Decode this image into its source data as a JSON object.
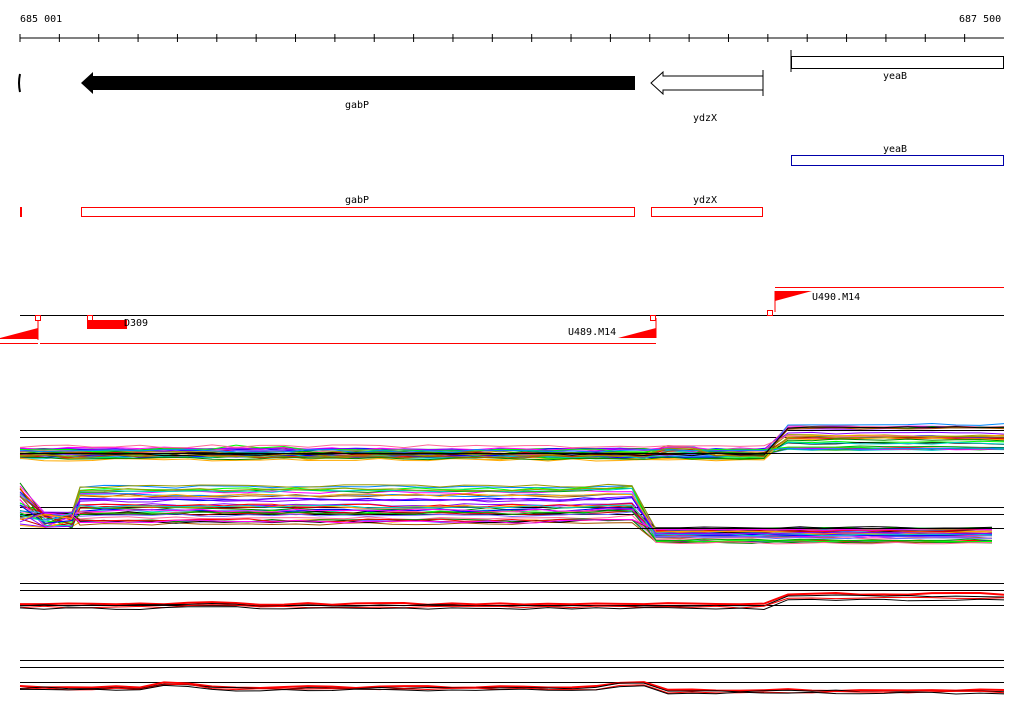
{
  "ruler": {
    "start_label": "685 001",
    "end_label": "687 500"
  },
  "genes": {
    "gabP_label": "gabP",
    "ydzX_label": "ydzX",
    "yeaB_label": "yeaB",
    "yeaB2_label": "yeaB",
    "gabP2_label": "gabP",
    "ydzX2_label": "ydzX"
  },
  "transcripts": {
    "u490_label": "U490.M14",
    "u489_label": "U489.M14",
    "d309_label": "D309"
  },
  "colors": {
    "gene_fill": "#000000",
    "feature_red": "#ff0000",
    "feature_blue": "#0000aa",
    "track_line": "#000000"
  },
  "tracks": [
    {
      "name": "expression-track-1",
      "count": "many-colored-lines"
    },
    {
      "name": "expression-track-2",
      "count": "many-colored-lines"
    },
    {
      "name": "expression-track-3",
      "count": "red-black-lines"
    },
    {
      "name": "expression-track-4",
      "count": "red-black-lines"
    }
  ]
}
